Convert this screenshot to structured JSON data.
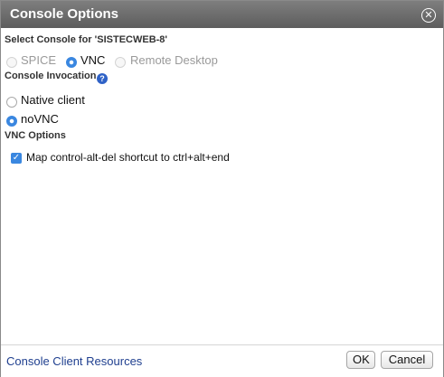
{
  "dialog": {
    "title": "Console Options",
    "close_icon": "close-icon"
  },
  "select_console": {
    "label": "Select Console for 'SISTECWEB-8'",
    "options": [
      {
        "label": "SPICE",
        "checked": false,
        "disabled": true
      },
      {
        "label": "VNC",
        "checked": true,
        "disabled": false
      },
      {
        "label": "Remote Desktop",
        "checked": false,
        "disabled": true
      }
    ]
  },
  "console_invocation": {
    "label": "Console Invocation",
    "help_icon": "help-icon",
    "help_glyph": "?",
    "options": [
      {
        "label": "Native client",
        "checked": false
      },
      {
        "label": "noVNC",
        "checked": true
      }
    ]
  },
  "vnc_options": {
    "label": "VNC Options",
    "map_ctrl_alt_del": {
      "label": "Map control-alt-del shortcut to ctrl+alt+end",
      "checked": true
    }
  },
  "footer": {
    "link": "Console Client Resources",
    "ok": "OK",
    "cancel": "Cancel"
  },
  "colors": {
    "titlebar": "#6e6e6e",
    "accent": "#3a87e0",
    "link": "#1f3f8f"
  }
}
